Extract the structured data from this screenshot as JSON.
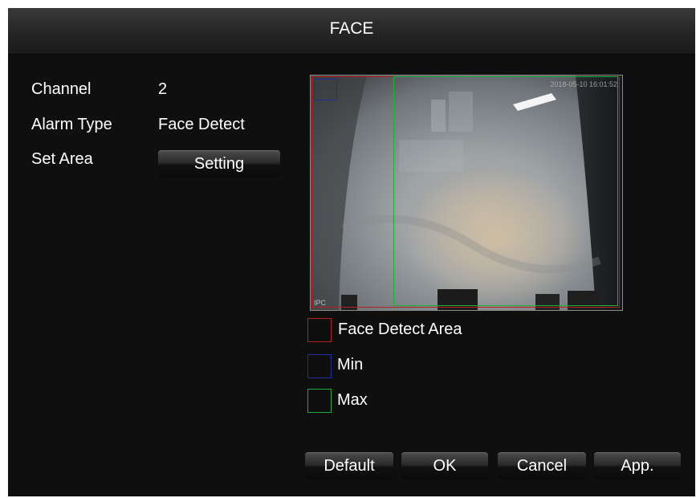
{
  "dialog": {
    "title": "FACE"
  },
  "form": {
    "channel_label": "Channel",
    "channel_value": "2",
    "alarm_type_label": "Alarm Type",
    "alarm_type_value": "Face Detect",
    "set_area_label": "Set Area",
    "setting_button": "Setting"
  },
  "preview": {
    "timestamp": "2018-05-10 16:01:52",
    "camera_tag": "IPC"
  },
  "legend": {
    "items": [
      {
        "label": "Face Detect Area",
        "color": "#b22222"
      },
      {
        "label": "Min",
        "color": "#1f2f9a"
      },
      {
        "label": "Max",
        "color": "#1fae3a"
      }
    ]
  },
  "buttons": {
    "default": "Default",
    "ok": "OK",
    "cancel": "Cancel",
    "apply": "App."
  },
  "colors": {
    "background": "#0f0f0f",
    "text": "#ffffff",
    "face_area": "#b22222",
    "min_box": "#1f2f9a",
    "max_box": "#1fae3a"
  }
}
